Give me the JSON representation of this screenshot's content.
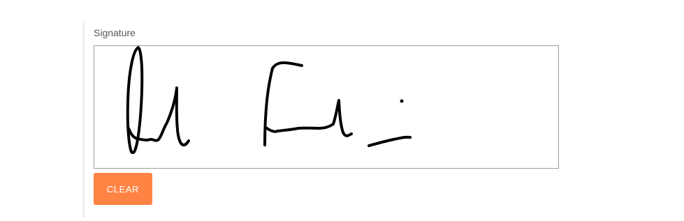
{
  "signature_field": {
    "label": "Signature",
    "clear_label": "CLEAR"
  },
  "colors": {
    "accent": "#ff8444",
    "ink": "#000000",
    "pad_border": "#9e9e9e",
    "label_text": "#555555"
  }
}
